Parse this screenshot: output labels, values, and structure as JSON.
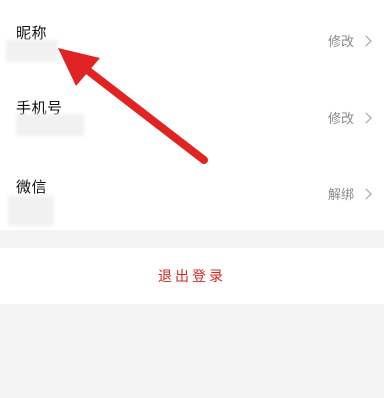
{
  "profile_rows": {
    "nickname": {
      "label": "昵称",
      "action": "修改"
    },
    "phone": {
      "label": "手机号",
      "action": "修改"
    },
    "wechat": {
      "label": "微信",
      "action": "解绑"
    }
  },
  "logout": {
    "label": "退出登录"
  },
  "colors": {
    "logout_text": "#d6271f",
    "annotation_arrow": "#e02424",
    "action_text": "#8a8a8a",
    "section_gap": "#f4f4f4"
  },
  "icons": {
    "row_chevron": "chevron-right-icon",
    "annotation": "red-arrow-annotation"
  }
}
